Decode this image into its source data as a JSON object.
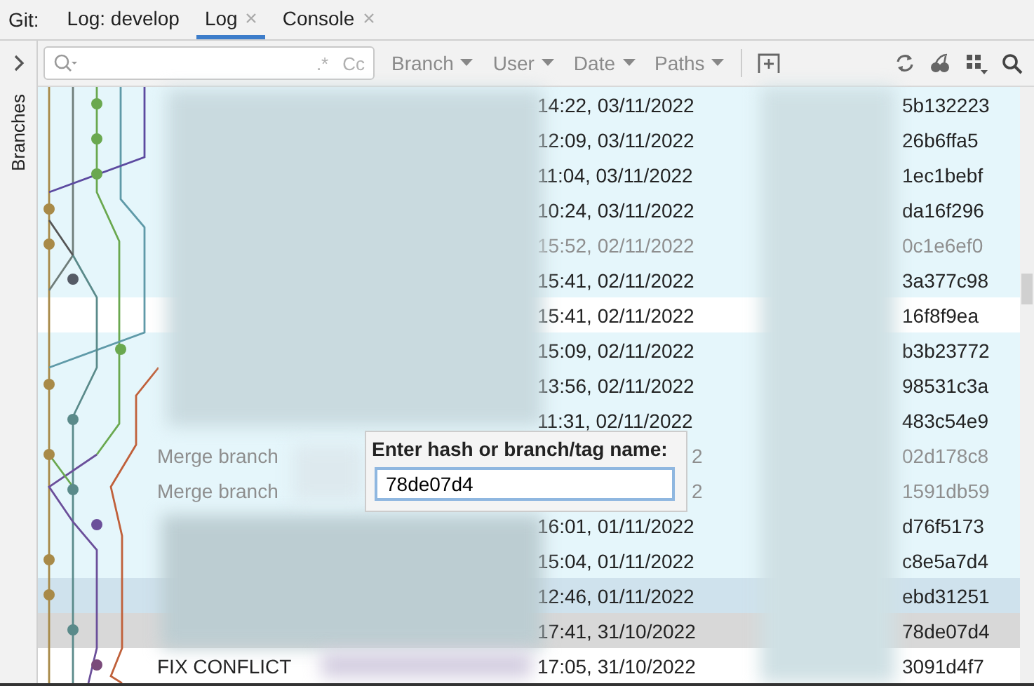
{
  "tool_window": {
    "label": "Git:",
    "tabs": [
      {
        "label": "Log: develop",
        "selected": false,
        "closable": false
      },
      {
        "label": "Log",
        "selected": true,
        "closable": true
      },
      {
        "label": "Console",
        "selected": false,
        "closable": true
      }
    ]
  },
  "side_panel": {
    "label": "Branches"
  },
  "toolbar": {
    "search": {
      "regex_toggle": ".*",
      "case_toggle": "Cc"
    },
    "filters": [
      "Branch",
      "User",
      "Date",
      "Paths"
    ]
  },
  "commits": [
    {
      "kind": "tint",
      "time": "14:22, 03/11/2022",
      "hash": "5b132223",
      "dimmed": false
    },
    {
      "kind": "tint",
      "time": "12:09, 03/11/2022",
      "hash": "26b6ffa5",
      "dimmed": false
    },
    {
      "kind": "tint",
      "time": "11:04, 03/11/2022",
      "hash": "1ec1bebf",
      "dimmed": false
    },
    {
      "kind": "tint",
      "time": "10:24, 03/11/2022",
      "hash": "da16f296",
      "dimmed": false
    },
    {
      "kind": "tint",
      "time": "15:52, 02/11/2022",
      "hash": "0c1e6ef0",
      "dimmed": true
    },
    {
      "kind": "tint",
      "time": "15:41, 02/11/2022",
      "hash": "3a377c98",
      "dimmed": false
    },
    {
      "kind": "plain",
      "time": "15:41, 02/11/2022",
      "hash": "16f8f9ea",
      "dimmed": false
    },
    {
      "kind": "tint",
      "time": "15:09, 02/11/2022",
      "hash": "b3b23772",
      "dimmed": false
    },
    {
      "kind": "tint",
      "time": "13:56, 02/11/2022",
      "hash": "98531c3a",
      "dimmed": false
    },
    {
      "kind": "tint",
      "time": "11:31, 02/11/2022",
      "hash": "483c54e9",
      "dimmed": false
    },
    {
      "kind": "tint",
      "subject": "Merge branch",
      "time_tail": "2",
      "hash": "02d178c8",
      "dimmed": true
    },
    {
      "kind": "tint",
      "subject": "Merge branch",
      "time_tail": "2",
      "hash": "1591db59",
      "dimmed": true
    },
    {
      "kind": "tint",
      "time": "16:01, 01/11/2022",
      "hash": "d76f5173",
      "dimmed": false
    },
    {
      "kind": "tint",
      "time": "15:04, 01/11/2022",
      "hash": "c8e5a7d4",
      "dimmed": false
    },
    {
      "kind": "selected",
      "time": "12:46, 01/11/2022",
      "hash": "ebd31251",
      "dimmed": false
    },
    {
      "kind": "match",
      "time": "17:41, 31/10/2022",
      "hash": "78de07d4",
      "dimmed": false
    },
    {
      "kind": "plain",
      "subject": "FIX CONFLICT",
      "time": "17:05, 31/10/2022",
      "hash": "3091d4f7",
      "dimmed": false
    }
  ],
  "goto_popup": {
    "label": "Enter hash or branch/tag name:",
    "value": "78de07d4"
  }
}
